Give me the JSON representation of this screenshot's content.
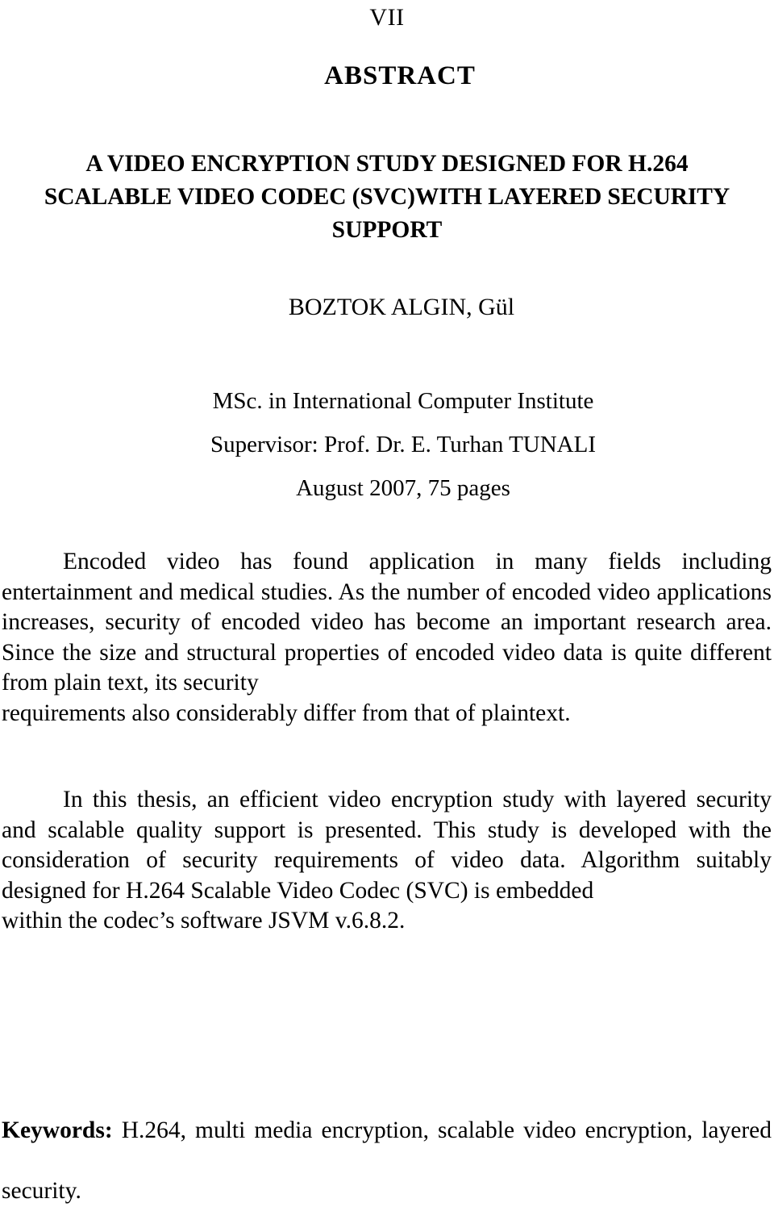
{
  "document": {
    "page_number": "VII",
    "section_heading": "ABSTRACT"
  },
  "title": {
    "line1": "A VIDEO ENCRYPTION STUDY DESIGNED FOR H.264",
    "line2": "SCALABLE VIDEO CODEC (SVC)WITH LAYERED SECURITY",
    "line3": "SUPPORT",
    "full": "A VIDEO ENCRYPTION STUDY DESIGNED FOR H.264 SCALABLE VIDEO CODEC (SVC)WITH LAYERED SECURITY SUPPORT"
  },
  "metadata": {
    "author": "BOZTOK ALGIN, Gül",
    "degree_program": "MSc. in International Computer Institute",
    "supervisor": "Supervisor: Prof. Dr. E. Turhan TUNALI",
    "date_and_pages": "August 2007, 75 pages"
  },
  "abstract": {
    "paragraph_1_main": "Encoded video has found application in many fields including entertainment and medical studies. As the number of encoded video applications increases, security of encoded video has become an important research area. Since the size and structural properties of encoded video data is quite different from plain text, its security",
    "paragraph_1_last_line": "requirements also considerably differ from that of plaintext.",
    "paragraph_2_main": "In this thesis, an efficient video encryption study with layered security and scalable quality support is presented. This study is developed with the consideration of security requirements of video data. Algorithm suitably designed for H.264 Scalable Video Codec (SVC) is embedded",
    "paragraph_2_last_line": "within the codec’s software JSVM v.6.8.2."
  },
  "keywords": {
    "label": "Keywords:",
    "line_1_values": "H.264, multi media encryption, scalable video encryption, layered",
    "line_2_values": "security.",
    "full_values": "H.264, multi media encryption, scalable video encryption, layered security."
  },
  "style": {
    "text_color": "#000000",
    "background_color": "#ffffff"
  }
}
